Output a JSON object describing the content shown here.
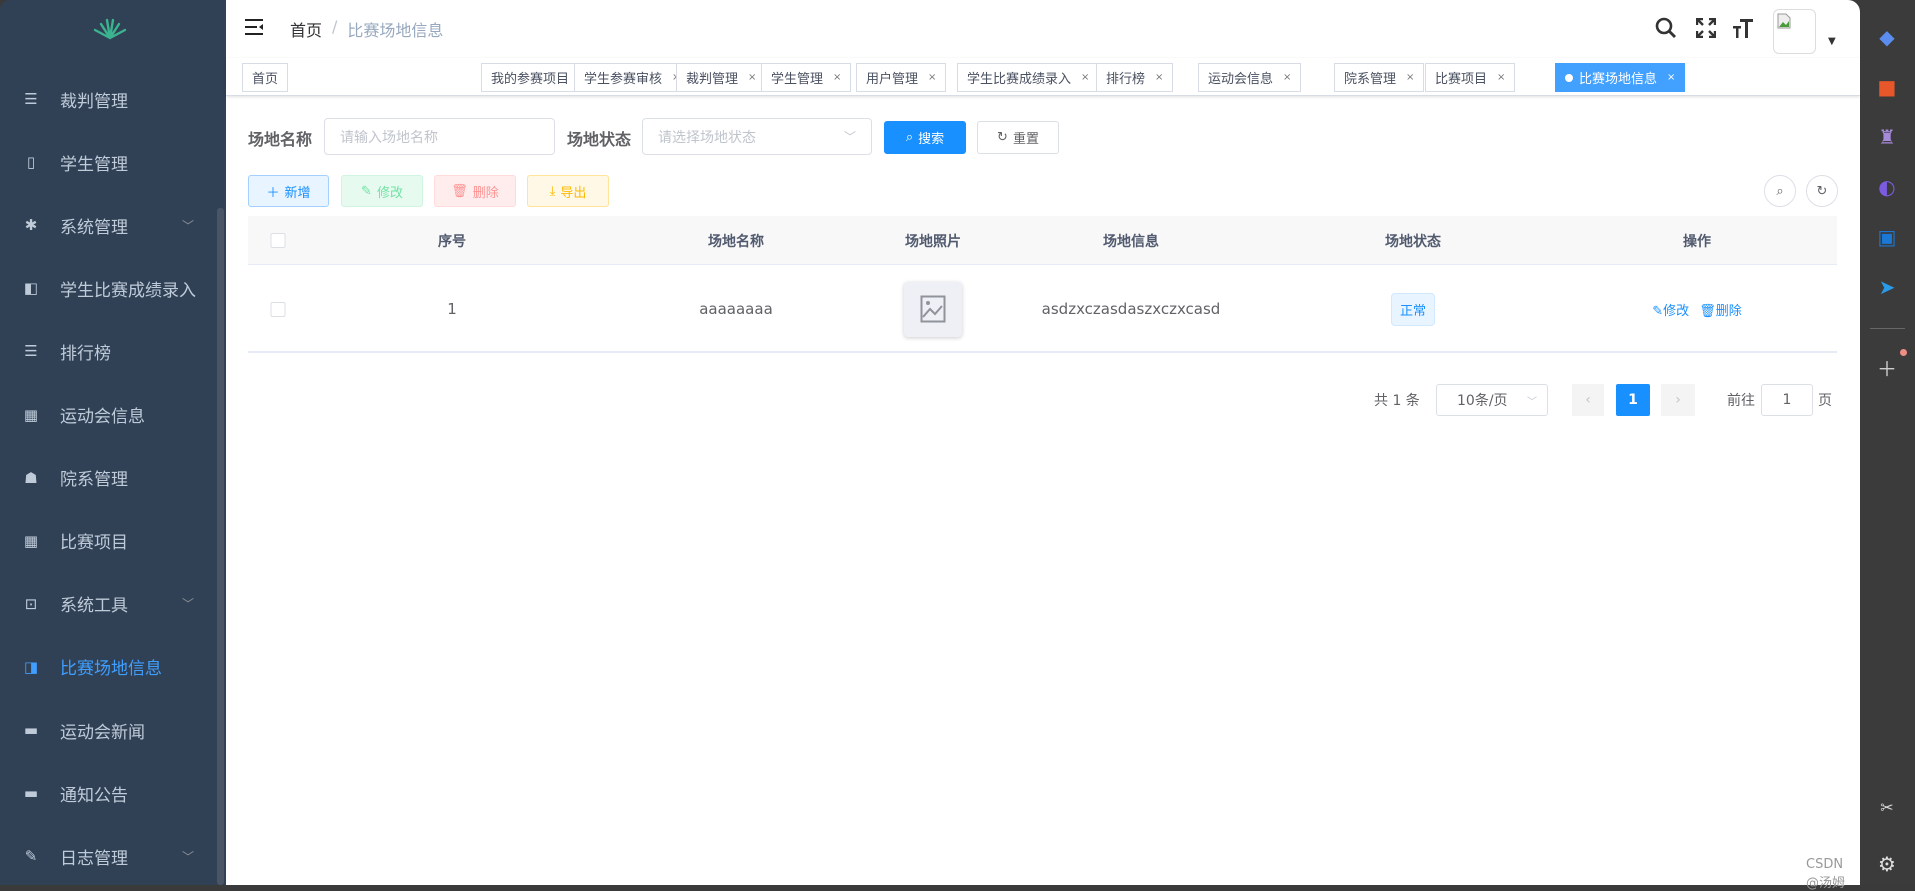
{
  "sidebar": {
    "items": [
      {
        "label": "裁判管理",
        "icon": "list-icon"
      },
      {
        "label": "学生管理",
        "icon": "book-icon"
      },
      {
        "label": "系统管理",
        "icon": "gear-icon",
        "expandable": true
      },
      {
        "label": "学生比赛成绩录入",
        "icon": "book-open-icon"
      },
      {
        "label": "排行榜",
        "icon": "list-icon"
      },
      {
        "label": "运动会信息",
        "icon": "table-icon"
      },
      {
        "label": "院系管理",
        "icon": "tree-icon"
      },
      {
        "label": "比赛项目",
        "icon": "table-icon"
      },
      {
        "label": "系统工具",
        "icon": "toolbox-icon",
        "expandable": true
      },
      {
        "label": "比赛场地信息",
        "icon": "documents-icon",
        "active": true
      },
      {
        "label": "运动会新闻",
        "icon": "message-icon"
      },
      {
        "label": "通知公告",
        "icon": "message-icon"
      },
      {
        "label": "日志管理",
        "icon": "edit-log-icon",
        "expandable": true
      }
    ]
  },
  "header": {
    "breadcrumb": [
      "首页",
      "比赛场地信息"
    ],
    "separator": "/"
  },
  "tags": [
    {
      "label": "首页",
      "closable": false
    },
    {
      "label": "我的参赛项目"
    },
    {
      "label": "学生参赛审核"
    },
    {
      "label": "裁判管理"
    },
    {
      "label": "学生管理"
    },
    {
      "label": "用户管理"
    },
    {
      "label": "学生比赛成绩录入"
    },
    {
      "label": "排行榜"
    },
    {
      "label": "运动会信息"
    },
    {
      "label": "院系管理"
    },
    {
      "label": "比赛项目"
    },
    {
      "label": "比赛场地信息",
      "active": true
    }
  ],
  "search": {
    "name_label": "场地名称",
    "name_placeholder": "请输入场地名称",
    "status_label": "场地状态",
    "status_placeholder": "请选择场地状态",
    "search_button": "搜索",
    "reset_button": "重置"
  },
  "toolbar": {
    "add": "新增",
    "edit": "修改",
    "delete": "删除",
    "export": "导出"
  },
  "table": {
    "columns": [
      "序号",
      "场地名称",
      "场地照片",
      "场地信息",
      "场地状态",
      "操作"
    ],
    "rows": [
      {
        "index": "1",
        "name": "aaaaaaaa",
        "info": "asdzxczasdaszxczxcasd",
        "status": "正常",
        "actions": [
          "修改",
          "删除"
        ]
      }
    ]
  },
  "pagination": {
    "total": "共 1 条",
    "page_size": "10条/页",
    "current": "1",
    "goto_label": "前往",
    "goto_value": "1",
    "page_suffix": "页"
  },
  "watermark": "CSDN @汤姆",
  "colors": {
    "primary": "#1890ff",
    "sidebar_bg": "#304156",
    "active_tag": "#42a0ff"
  }
}
